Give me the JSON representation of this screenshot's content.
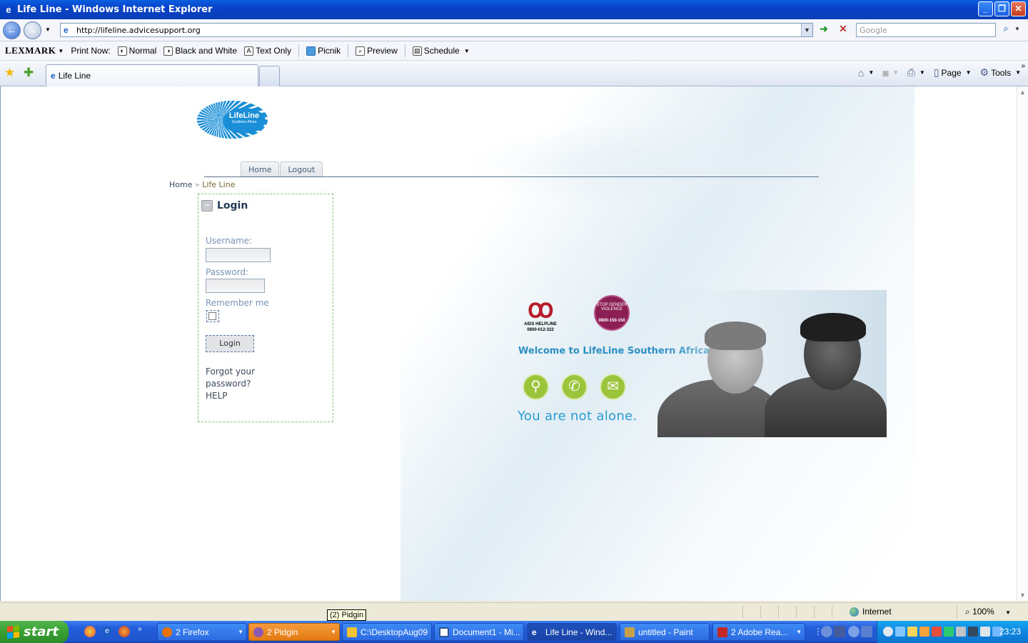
{
  "window": {
    "title": "Life Line - Windows Internet Explorer"
  },
  "address": {
    "url": "http://lifeline.advicesupport.org",
    "search_placeholder": "Google"
  },
  "lexmark": {
    "brand": "LEXMARK",
    "print_now": "Print Now:",
    "items": [
      "Normal",
      "Black and White",
      "Text Only",
      "Picnik",
      "Preview",
      "Schedule"
    ]
  },
  "tabs": {
    "active": "Life Line"
  },
  "commandbar": {
    "page": "Page",
    "tools": "Tools"
  },
  "site": {
    "logo_line1": "LifeLine",
    "logo_line2": "Southern Africa",
    "nav": [
      "Home",
      "Logout"
    ],
    "breadcrumb_home": "Home",
    "breadcrumb_sep": "»",
    "breadcrumb_current": "Life Line"
  },
  "login": {
    "title": "Login",
    "username_label": "Username:",
    "password_label": "Password:",
    "remember_label": "Remember me",
    "button": "Login",
    "forgot_line1": "Forgot your",
    "forgot_line2": "password?",
    "help": "HELP"
  },
  "banner": {
    "aids_line1": "AIDS HELPLINE",
    "aids_line2": "0800-012-322",
    "gbv_line1": "STOP GENDER VIOLENCE",
    "gbv_line2": "0800-150-150",
    "welcome": "Welcome to LifeLine Southern Africa.",
    "tagline": "You are not alone."
  },
  "status": {
    "zone": "Internet",
    "zoom": "100%",
    "tooltip": "(2) Pidgin"
  },
  "taskbar": {
    "start": "start",
    "tasks": [
      {
        "label": "2 Firefox",
        "color": "#e8710a"
      },
      {
        "label": "2 Pidgin",
        "color": "#8a5ab0"
      },
      {
        "label": "C:\\DesktopAug09",
        "color": "#f1c232"
      },
      {
        "label": "Document1 - Mi...",
        "color": "#2b579a"
      },
      {
        "label": "Life Line - Wind...",
        "color": "#1c5dc7"
      },
      {
        "label": "untitled - Paint",
        "color": "#c9a04a"
      },
      {
        "label": "2 Adobe Rea...",
        "color": "#c62828"
      }
    ],
    "clock": "23:23"
  },
  "colors": {
    "accent": "#2b8fc2",
    "login_border": "#89c67c"
  }
}
